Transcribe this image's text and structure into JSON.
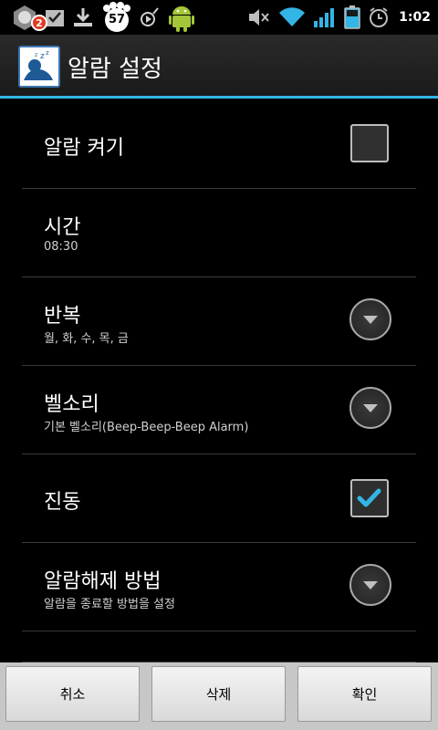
{
  "status_bar": {
    "notification_badge": "2",
    "paw_count": "57",
    "clock": "1:02"
  },
  "header": {
    "title": "알람 설정"
  },
  "settings": {
    "alarm_on": {
      "label": "알람 켜기",
      "checked": false
    },
    "time": {
      "label": "시간",
      "value": "08:30"
    },
    "repeat": {
      "label": "반복",
      "value": "월, 화, 수, 목, 금"
    },
    "ringtone": {
      "label": "벨소리",
      "value": "기본 벨소리(Beep-Beep-Beep Alarm)"
    },
    "vibrate": {
      "label": "진동",
      "checked": true
    },
    "dismiss_method": {
      "label": "알람해제 방법",
      "value": "알람을 종료할 방법을 설정"
    }
  },
  "footer": {
    "cancel_label": "취소",
    "delete_label": "삭제",
    "confirm_label": "확인"
  },
  "colors": {
    "accent": "#33b5e5",
    "check": "#33b5e5",
    "badge": "#e03a24",
    "android_green": "#a4c639"
  }
}
